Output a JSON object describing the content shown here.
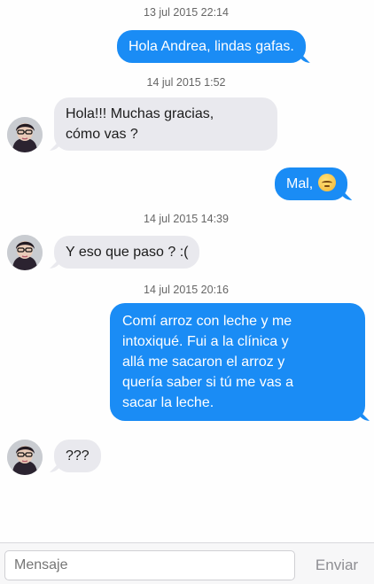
{
  "messages": [
    {
      "timestamp": "13 jul 2015 22:14",
      "direction": "outgoing",
      "text": "Hola Andrea, lindas gafas."
    },
    {
      "timestamp": "14 jul 2015 1:52",
      "direction": "incoming",
      "lines": [
        "Hola!!! Muchas gracias,",
        "cómo vas ?"
      ]
    },
    {
      "direction": "outgoing",
      "text": "Mal,",
      "emoji": "pensive-face-emoji"
    },
    {
      "timestamp": "14 jul 2015 14:39",
      "direction": "incoming",
      "text": "Y eso que paso ? :("
    },
    {
      "timestamp": "14 jul 2015 20:16",
      "direction": "outgoing",
      "lines": [
        "Comí arroz con leche y me",
        "intoxiqué. Fui a la clínica y",
        "allá me sacaron el arroz y",
        "quería saber si tú me vas a",
        "sacar la leche."
      ]
    },
    {
      "direction": "incoming",
      "text": "???"
    }
  ],
  "composer": {
    "placeholder": "Mensaje",
    "send_label": "Enviar"
  },
  "colors": {
    "outgoing_bubble": "#1a8cf5",
    "incoming_bubble": "#e9e9ee",
    "send_label": "#8e8e93"
  },
  "icons": {
    "contact_avatar": "avatar-woman-glasses-icon"
  }
}
